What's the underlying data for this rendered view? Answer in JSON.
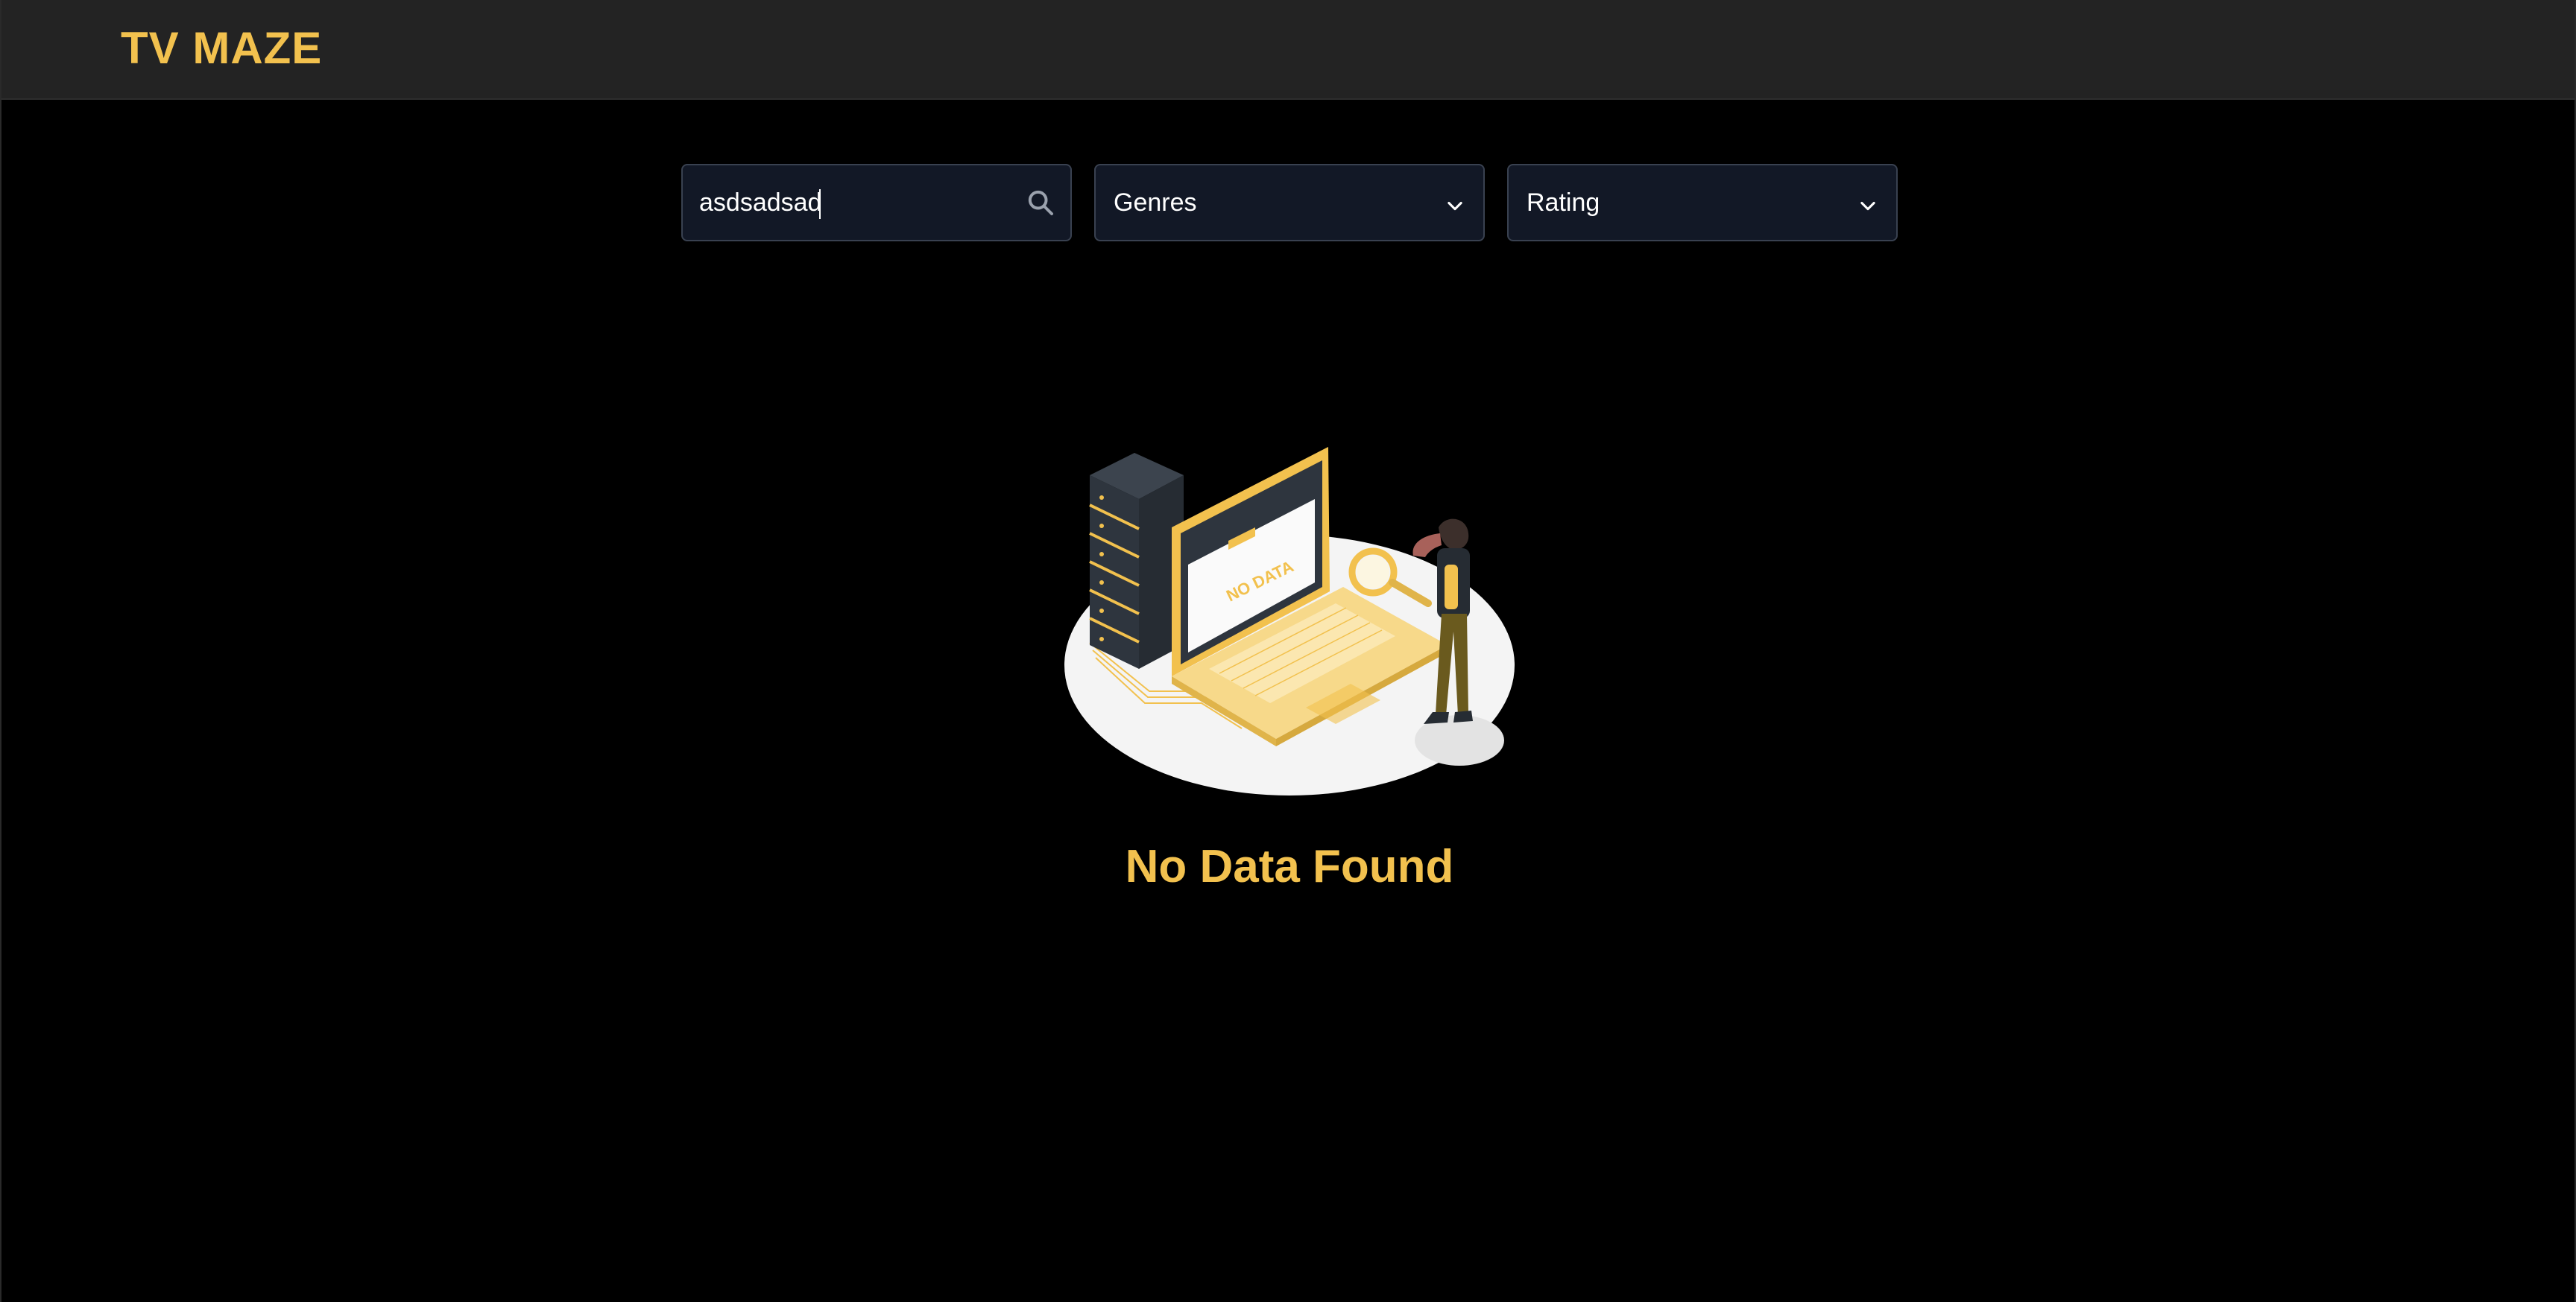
{
  "navbar": {
    "brand": "TV MAZE"
  },
  "filters": {
    "search": {
      "value": "asdsadsad",
      "icon": "search-icon"
    },
    "genres": {
      "label": "Genres",
      "icon": "chevron-down-icon"
    },
    "rating": {
      "label": "Rating",
      "icon": "chevron-down-icon"
    }
  },
  "empty_state": {
    "illustration": "no-data-illustration",
    "illustration_text": "NO DATA",
    "title": "No Data Found"
  },
  "colors": {
    "accent": "#f2c14e",
    "navbar_bg": "#232323",
    "page_bg": "#000000",
    "field_bg": "#121826",
    "field_border": "#394150"
  }
}
